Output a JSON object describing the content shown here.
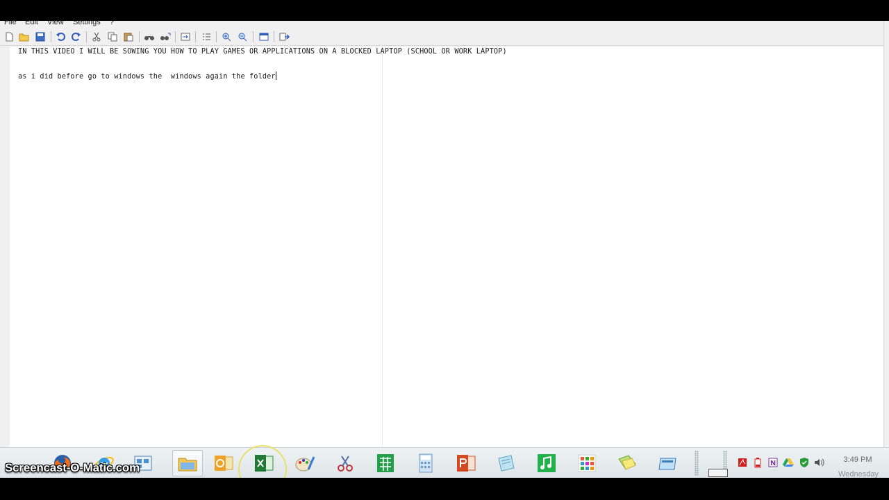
{
  "menu": {
    "items": [
      "File",
      "Edit",
      "View",
      "Settings",
      "?"
    ]
  },
  "toolbar": {
    "buttons": [
      "new-file-icon",
      "open-folder-icon",
      "save-icon",
      "undo-icon",
      "redo-icon",
      "cut-icon",
      "copy-icon",
      "paste-icon",
      "find-icon",
      "replace-icon",
      "goto-icon",
      "list-icon",
      "zoom-in-icon",
      "zoom-out-icon",
      "view-icon",
      "run-icon"
    ]
  },
  "editor": {
    "lines": [
      "IN THIS VIDEO I WILL BE SOWING YOU HOW TO PLAY GAMES OR APPLICATIONS ON A BLOCKED LAPTOP (SCHOOL OR WORK LAPTOP)",
      "",
      "as i did before go to windows the  windows again the folder"
    ]
  },
  "taskbar": {
    "apps": [
      "firefox-icon",
      "internet-explorer-icon",
      "control-panel-icon",
      "file-explorer-icon",
      "outlook-icon",
      "excel-icon",
      "paint-icon",
      "snipping-tool-icon",
      "numbers-icon",
      "calculator-icon",
      "powerpoint-icon",
      "notepad-icon",
      "music-icon",
      "apps-grid-icon",
      "sticky-notes-icon",
      "window-icon"
    ],
    "tray": [
      "acrobat-icon",
      "battery-icon",
      "onenote-icon",
      "drive-icon",
      "security-icon",
      "volume-icon"
    ],
    "time": "3:49 PM",
    "day": "Wednesday"
  },
  "watermark": "Screencast-O-Matic.com",
  "colors": {
    "taskbar": "#e6ebee",
    "editor_bg": "#ffffff",
    "toolbar_bg": "#f0f0f0"
  }
}
